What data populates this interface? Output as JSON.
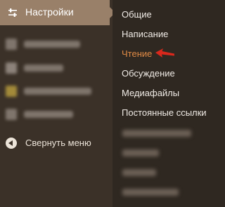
{
  "sidebar": {
    "active_item": {
      "label": "Настройки",
      "icon": "settings-sliders-icon"
    },
    "collapse_label": "Свернуть меню",
    "collapse_icon": "collapse-arrow-icon"
  },
  "submenu": {
    "items": [
      {
        "label": "Общие"
      },
      {
        "label": "Написание"
      },
      {
        "label": "Чтение"
      },
      {
        "label": "Обсуждение"
      },
      {
        "label": "Медиафайлы"
      },
      {
        "label": "Постоянные ссылки"
      }
    ],
    "current_item_color": "#e08a45"
  },
  "annotation": {
    "pointer_color": "#d9281c"
  },
  "theme": {
    "sidebar_bg": "#3b3128",
    "active_bg": "#998069",
    "submenu_bg": "#2f2821",
    "text_color": "#f0ebe6"
  }
}
